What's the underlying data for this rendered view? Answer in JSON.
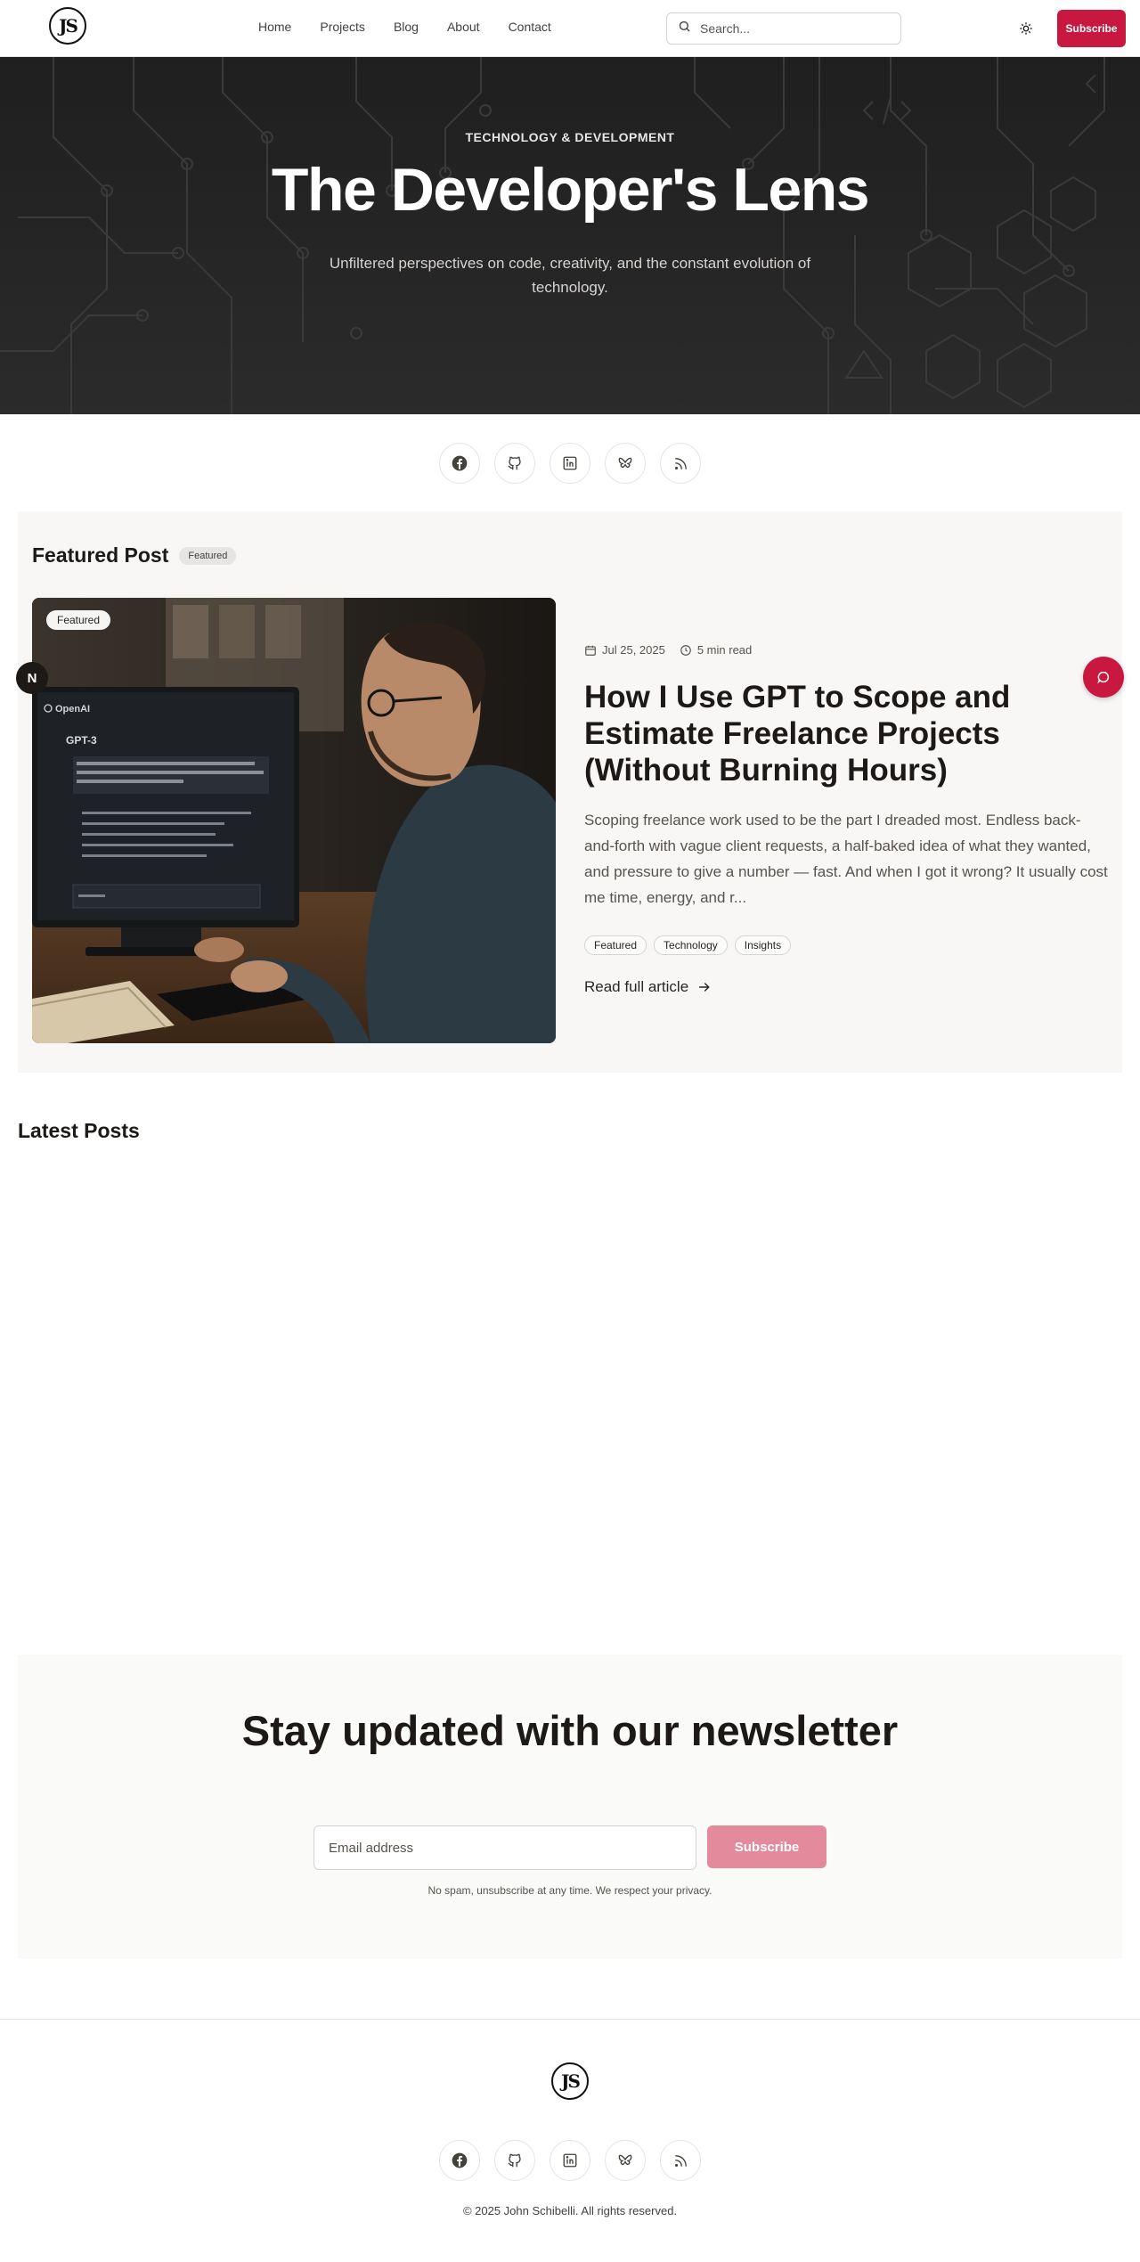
{
  "header": {
    "logo_text": "JS",
    "nav": [
      "Home",
      "Projects",
      "Blog",
      "About",
      "Contact"
    ],
    "search_placeholder": "Search...",
    "subscribe_label": "Subscribe"
  },
  "hero": {
    "kicker": "TECHNOLOGY & DEVELOPMENT",
    "title": "The Developer's Lens",
    "subtitle": "Unfiltered perspectives on code, creativity, and the constant evolution of technology."
  },
  "social_icons": [
    "facebook-icon",
    "github-icon",
    "linkedin-icon",
    "bluesky-icon",
    "rss-icon"
  ],
  "featured": {
    "heading": "Featured Post",
    "badge": "Featured",
    "image_badge": "Featured",
    "image_screen_brand": "OpenAI",
    "image_screen_title": "GPT-3",
    "date": "Jul 25, 2025",
    "read_time": "5 min read",
    "title": "How I Use GPT to Scope and Estimate Freelance Projects (Without Burning Hours)",
    "excerpt": "Scoping freelance work used to be the part I dreaded most. Endless back-and-forth with vague client requests, a half-baked idea of what they wanted, and pressure to give a number — fast. And when I got it wrong? It usually cost me time, energy, and r...",
    "tags": [
      "Featured",
      "Technology",
      "Insights"
    ],
    "read_more": "Read full article"
  },
  "carousel_button_label": "N",
  "latest": {
    "heading": "Latest Posts"
  },
  "newsletter": {
    "title": "Stay updated with our newsletter",
    "email_placeholder": "Email address",
    "button_label": "Subscribe",
    "note": "No spam, unsubscribe at any time. We respect your privacy."
  },
  "footer": {
    "logo_text": "JS",
    "copyright": "© 2025 John Schibelli. All rights reserved."
  },
  "colors": {
    "accent": "#c8183f",
    "accent_muted": "#e38a9c",
    "hero_bg": "#232323"
  }
}
